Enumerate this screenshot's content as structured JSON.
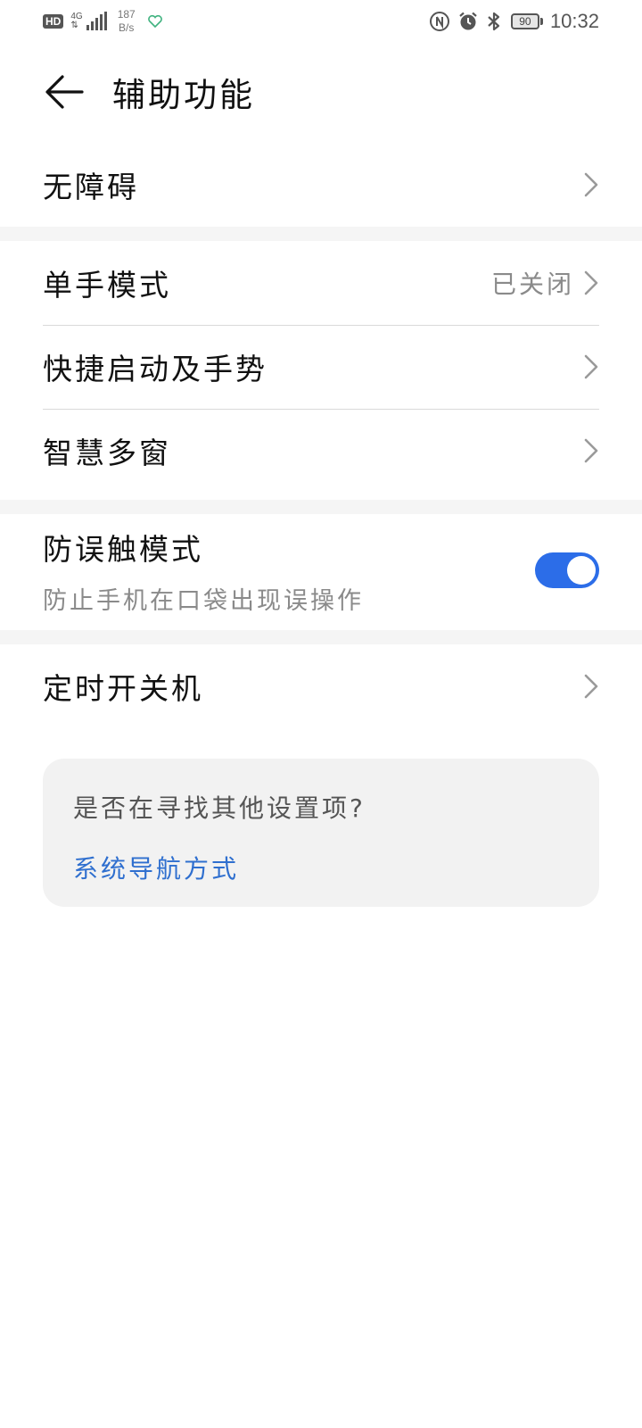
{
  "status_bar": {
    "hd": "HD",
    "network_type": "4G",
    "network_sub": "⇅",
    "net_speed_value": "187",
    "net_speed_unit": "B/s",
    "battery": "90",
    "time": "10:32",
    "icons": [
      "signal-icon",
      "heart-icon",
      "nfc-icon",
      "alarm-icon",
      "bluetooth-icon",
      "battery-icon"
    ]
  },
  "header": {
    "title": "辅助功能",
    "back_icon": "arrow-left-icon"
  },
  "groups": [
    {
      "items": [
        {
          "label": "无障碍",
          "value": ""
        }
      ]
    },
    {
      "items": [
        {
          "label": "单手模式",
          "value": "已关闭"
        },
        {
          "label": "快捷启动及手势",
          "value": ""
        },
        {
          "label": "智慧多窗",
          "value": ""
        }
      ]
    },
    {
      "items": [
        {
          "label": "防误触模式",
          "subtitle": "防止手机在口袋出现误操作",
          "toggle_on": true
        }
      ]
    },
    {
      "items": [
        {
          "label": "定时开关机",
          "value": ""
        }
      ]
    }
  ],
  "suggestion": {
    "question": "是否在寻找其他设置项?",
    "link": "系统导航方式"
  },
  "colors": {
    "accent": "#2c6de8",
    "link": "#2f6fcf",
    "separator": "#f5f5f5",
    "card_bg": "#f2f2f2"
  }
}
